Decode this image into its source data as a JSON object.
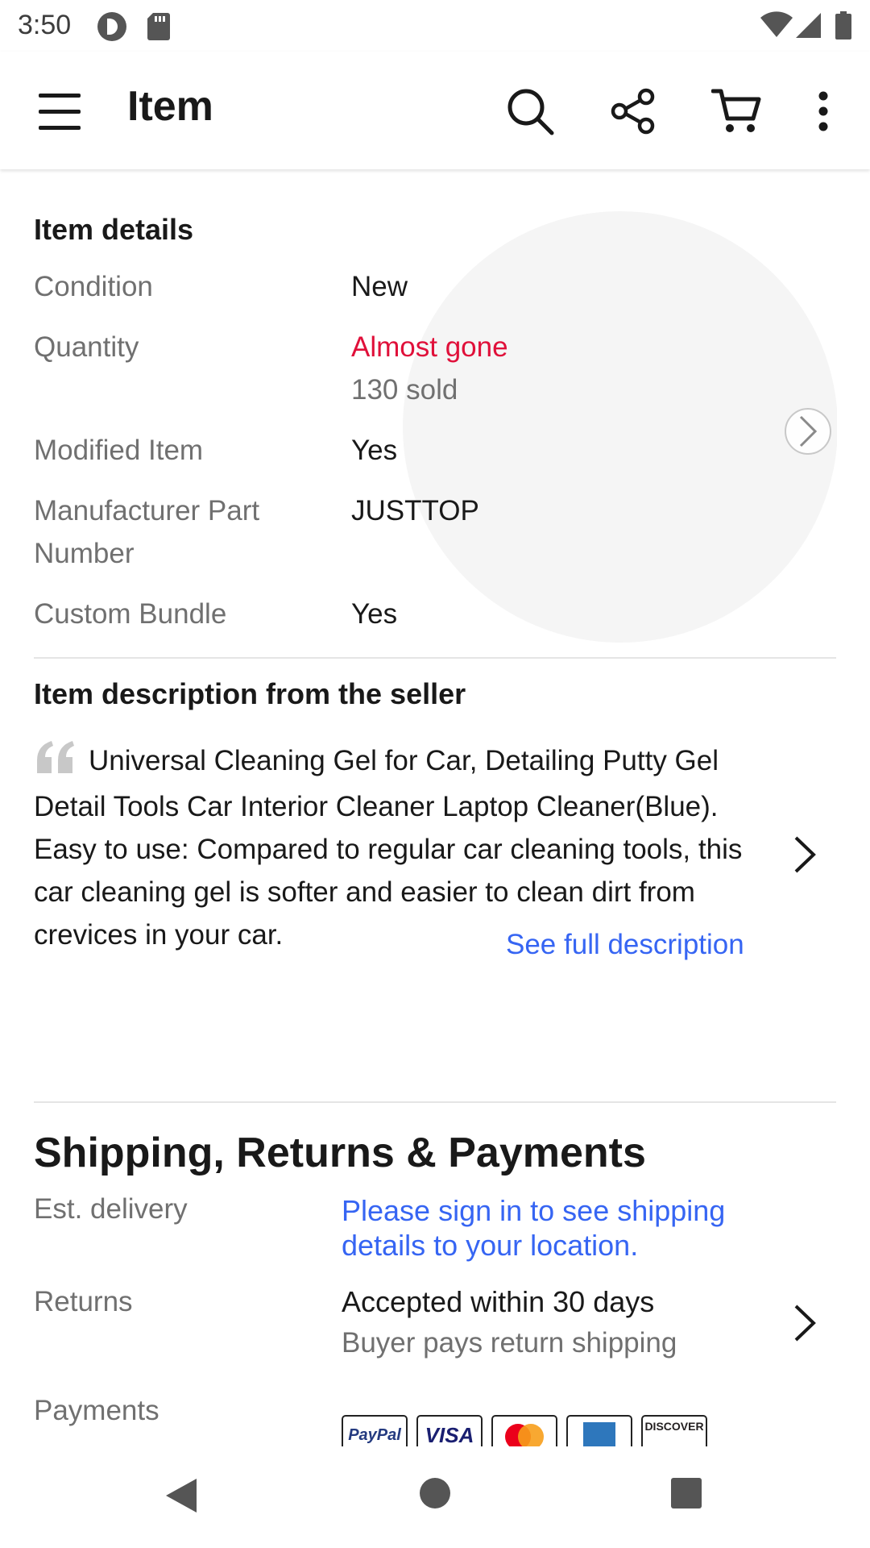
{
  "status_bar": {
    "time": "3:50"
  },
  "app_bar": {
    "title": "Item"
  },
  "item_details": {
    "heading": "Item details",
    "rows": [
      {
        "label": "Condition",
        "value": "New"
      },
      {
        "label": "Quantity",
        "value": "Almost gone",
        "subvalue": "130 sold"
      },
      {
        "label": "Modified Item",
        "value": "Yes"
      },
      {
        "label_line1": "Manufacturer Part",
        "label_line2": "Number",
        "value": "JUSTTOP"
      },
      {
        "label": "Custom Bundle",
        "value": "Yes"
      }
    ]
  },
  "description": {
    "heading": "Item description from the seller",
    "text": "Universal Cleaning Gel for Car, Detailing Putty Gel Detail Tools Car Interior Cleaner Laptop Cleaner(Blue). Easy to use: Compared to regular car cleaning tools, this car cleaning gel is softer and easier to clean dirt from crevices in your car.",
    "see_full": "See full description"
  },
  "shipping": {
    "heading": "Shipping, Returns & Payments",
    "est_delivery_label": "Est. delivery",
    "est_delivery_line1": "Please sign in to see shipping",
    "est_delivery_line2": "details to your location.",
    "returns_label": "Returns",
    "returns_value": "Accepted within 30 days",
    "returns_sub": "Buyer pays return shipping",
    "payments_label": "Payments",
    "payment_methods": [
      "PayPal",
      "VISA",
      "Mastercard",
      "American Express",
      "DISCOVER"
    ]
  },
  "colors": {
    "accent_link": "#3665f3",
    "urgency_red": "#e0103a",
    "muted_text": "#707070"
  }
}
